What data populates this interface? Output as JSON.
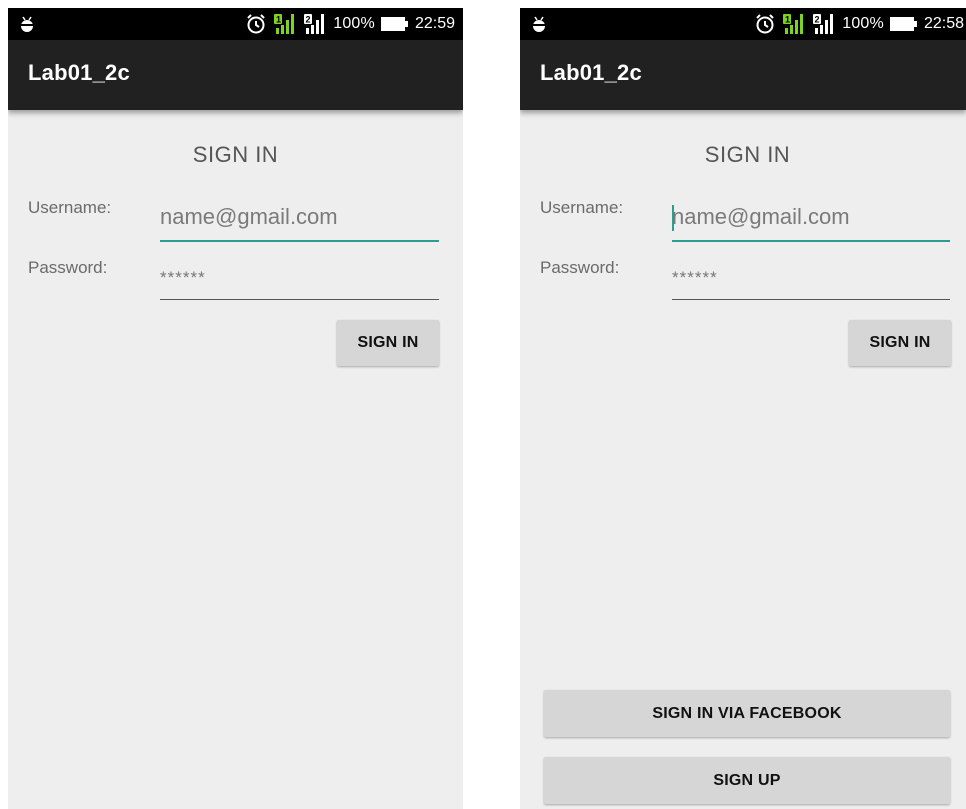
{
  "screens": [
    {
      "status": {
        "battery": "100%",
        "time": "22:59"
      },
      "app_title": "Lab01_2c",
      "heading": "SIGN IN",
      "username_label": "Username:",
      "username_value": "name@gmail.com",
      "password_label": "Password:",
      "password_value": "******",
      "signin_button": "SIGN IN"
    },
    {
      "status": {
        "battery": "100%",
        "time": "22:58"
      },
      "app_title": "Lab01_2c",
      "heading": "SIGN IN",
      "username_label": "Username:",
      "username_value": "name@gmail.com",
      "password_label": "Password:",
      "password_value": "******",
      "signin_button": "SIGN IN",
      "facebook_button": "SIGN IN VIA FACEBOOK",
      "signup_button": "SIGN UP"
    }
  ],
  "colors": {
    "app_bar": "#212121",
    "status_bar": "#000000",
    "background": "#eeeeee",
    "accent": "#2a9d8f",
    "button": "#d6d6d6",
    "signal_green": "#7ed321"
  },
  "icons": [
    "android-debug-icon",
    "alarm-icon",
    "sim1-signal-icon",
    "sim2-signal-icon",
    "battery-icon"
  ]
}
